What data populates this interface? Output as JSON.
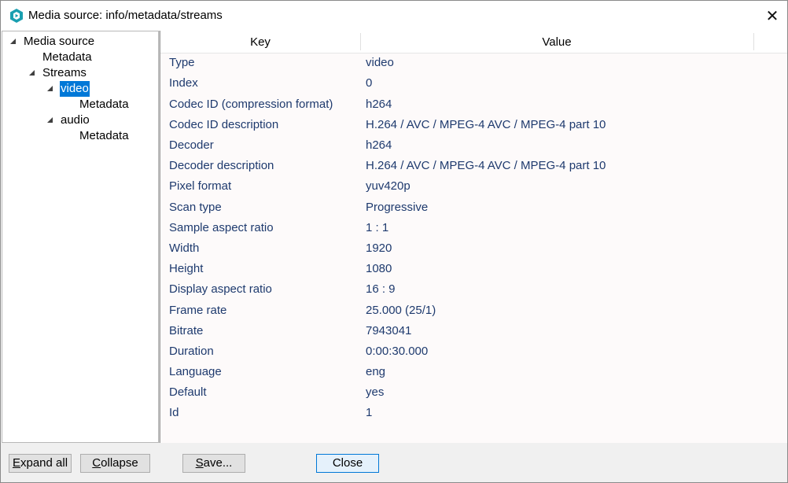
{
  "window": {
    "title": "Media source: info/metadata/streams"
  },
  "tree": {
    "root": "Media source",
    "root_metadata": "Metadata",
    "streams": "Streams",
    "video": "video",
    "video_metadata": "Metadata",
    "audio": "audio",
    "audio_metadata": "Metadata"
  },
  "table": {
    "headers": {
      "key": "Key",
      "value": "Value"
    },
    "rows": [
      {
        "key": "Type",
        "value": "video"
      },
      {
        "key": "Index",
        "value": "0"
      },
      {
        "key": "Codec ID (compression format)",
        "value": "h264"
      },
      {
        "key": "Codec ID description",
        "value": "H.264 / AVC / MPEG-4 AVC / MPEG-4 part 10"
      },
      {
        "key": "Decoder",
        "value": "h264"
      },
      {
        "key": "Decoder description",
        "value": "H.264 / AVC / MPEG-4 AVC / MPEG-4 part 10"
      },
      {
        "key": "Pixel format",
        "value": "yuv420p"
      },
      {
        "key": "Scan type",
        "value": "Progressive"
      },
      {
        "key": "Sample aspect ratio",
        "value": "1 : 1"
      },
      {
        "key": "Width",
        "value": "1920"
      },
      {
        "key": "Height",
        "value": "1080"
      },
      {
        "key": "Display aspect ratio",
        "value": "16 : 9"
      },
      {
        "key": "Frame rate",
        "value": "25.000 (25/1)"
      },
      {
        "key": "Bitrate",
        "value": "7943041"
      },
      {
        "key": "Duration",
        "value": "0:00:30.000"
      },
      {
        "key": "Language",
        "value": "eng"
      },
      {
        "key": "Default",
        "value": "yes"
      },
      {
        "key": "Id",
        "value": "1"
      }
    ]
  },
  "buttons": {
    "expand_all": {
      "mnemonic": "E",
      "rest": "xpand all"
    },
    "collapse": {
      "mnemonic": "C",
      "rest": "ollapse"
    },
    "save": {
      "mnemonic": "S",
      "rest": "ave..."
    },
    "close": "Close"
  },
  "icons": {
    "app": "app-hexagon-icon",
    "close": "close-icon",
    "expand": "expand-triangle-icon"
  },
  "colors": {
    "selection": "#0078d7",
    "cell_text": "#1e3a6e",
    "grid_bg": "#fdfafa",
    "focus_border": "#0078d7"
  }
}
